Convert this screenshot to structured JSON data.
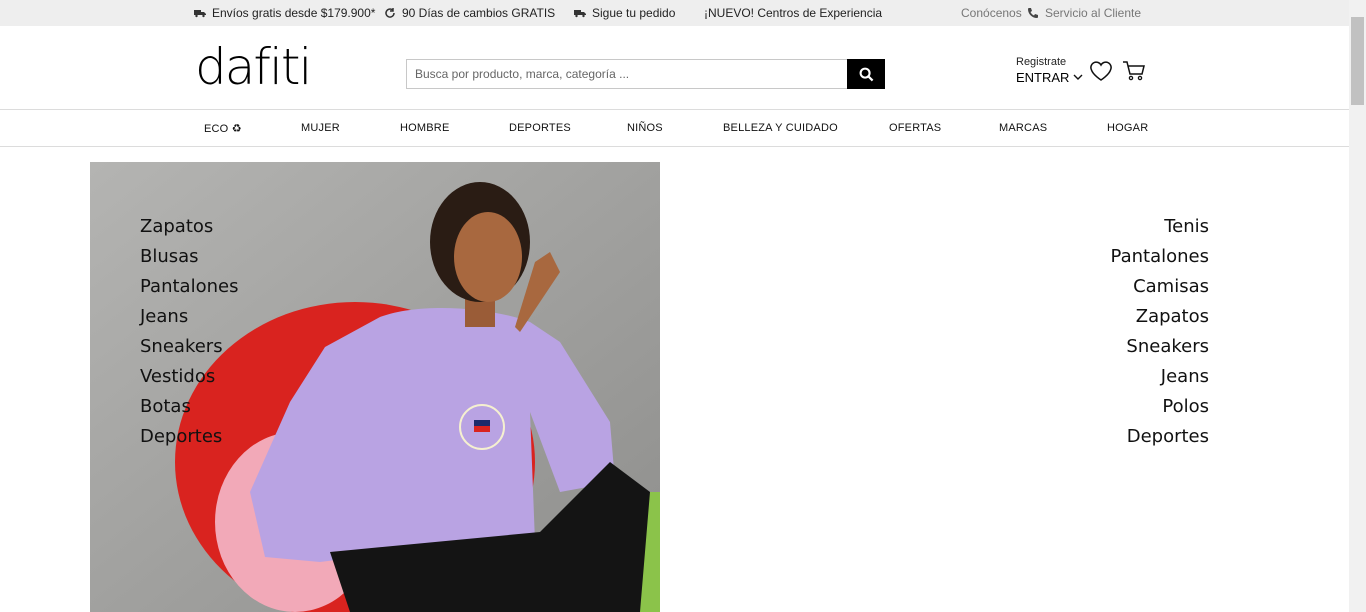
{
  "topbar": {
    "shipping": "Envíos gratis desde $179.900*",
    "returns": "90 Días de cambios GRATIS",
    "tracking": "Sigue tu pedido",
    "experience": "¡NUEVO! Centros de Experiencia",
    "about": "Conócenos",
    "support": "Servicio al Cliente",
    "icons": [
      "truck-icon",
      "refresh-icon",
      "truck-icon",
      "phone-icon"
    ]
  },
  "header": {
    "logo": "dafiti",
    "search_placeholder": "Busca por producto, marca, categoría ...",
    "register": "Registrate",
    "login": "ENTRAR"
  },
  "nav": {
    "items": [
      "ECO ♻",
      "MUJER",
      "HOMBRE",
      "DEPORTES",
      "NIÑOS",
      "BELLEZA Y CUIDADO",
      "OFERTAS",
      "MARCAS",
      "HOGAR"
    ]
  },
  "women_categories": [
    "Zapatos",
    "Blusas",
    "Pantalones",
    "Jeans",
    "Sneakers",
    "Vestidos",
    "Botas",
    "Deportes"
  ],
  "men_categories": [
    "Tenis",
    "Pantalones",
    "Camisas",
    "Zapatos",
    "Sneakers",
    "Jeans",
    "Polos",
    "Deportes"
  ],
  "colors": {
    "topbar_bg": "#eeeeee",
    "accent": "#000000",
    "sweater": "#b9a3e3",
    "chair": "#d9231f"
  }
}
